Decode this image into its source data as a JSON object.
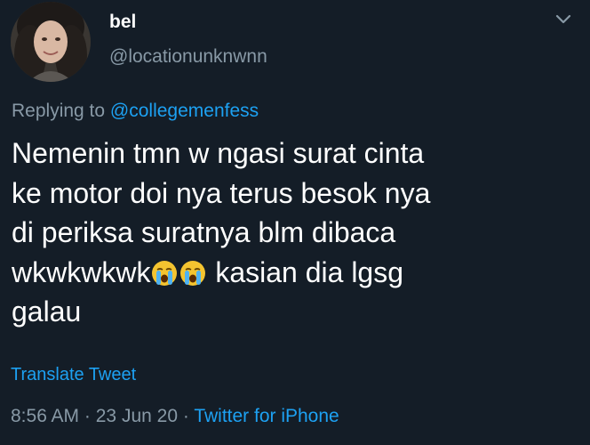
{
  "user": {
    "display_name": "bel",
    "handle": "@locationunknwnn"
  },
  "reply": {
    "prefix": "Replying to ",
    "mention": "@collegemenfess"
  },
  "tweet": {
    "lines": [
      "Nemenin tmn w ngasi surat cinta",
      "ke motor doi nya terus besok nya",
      "di periksa suratnya blm dibaca",
      "wkwkwkwk",
      "kasian dia lgsg",
      "galau"
    ],
    "emoji": [
      "loudly-crying-face",
      "loudly-crying-face"
    ]
  },
  "actions": {
    "translate_label": "Translate Tweet"
  },
  "meta": {
    "time": "8:56 AM",
    "date": "23 Jun 20",
    "source": "Twitter for iPhone",
    "separator": "·"
  },
  "colors": {
    "background": "#141d27",
    "text": "#ffffff",
    "secondary": "#8899a6",
    "link": "#1da1f2"
  }
}
